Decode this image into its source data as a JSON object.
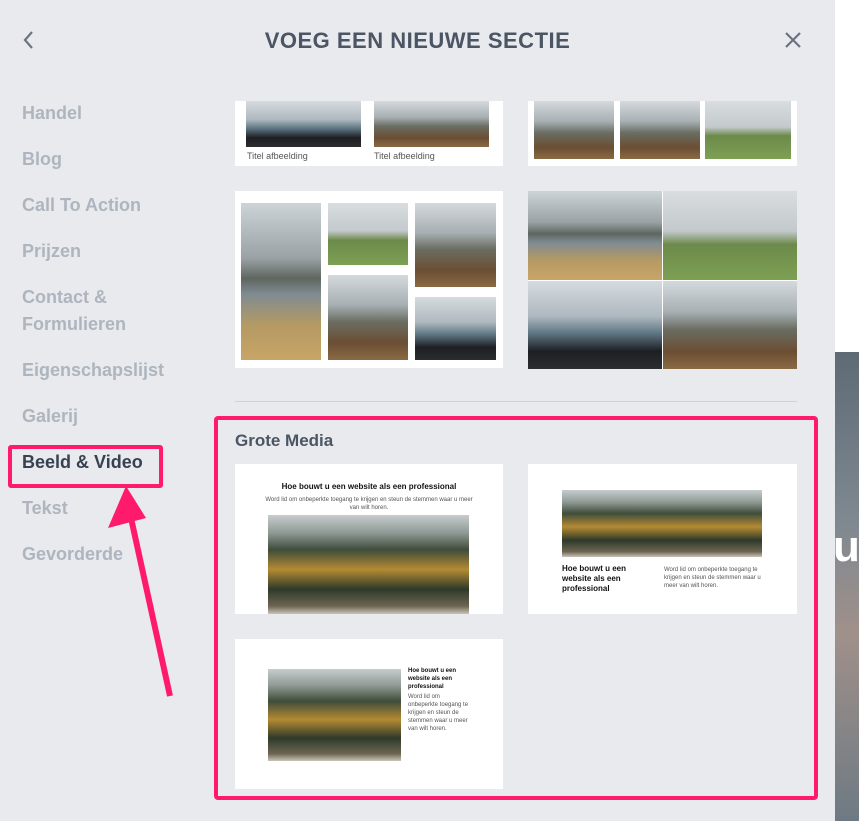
{
  "header": {
    "title": "VOEG EEN NIEUWE SECTIE"
  },
  "sidebar": {
    "items": [
      {
        "label": "Handel"
      },
      {
        "label": "Blog"
      },
      {
        "label": "Call To Action"
      },
      {
        "label": "Prijzen"
      },
      {
        "label": "Contact & Formulieren"
      },
      {
        "label": "Eigenschapslijst"
      },
      {
        "label": "Galerij"
      },
      {
        "label": "Beeld & Video"
      },
      {
        "label": "Tekst"
      },
      {
        "label": "Gevorderde"
      }
    ],
    "active": "Beeld & Video"
  },
  "gallery_top": {
    "captions": [
      "Titel afbeelding",
      "Titel afbeelding"
    ]
  },
  "section": {
    "title": "Grote Media",
    "heading": "Hoe bouwt u een website als een professional",
    "paragraph": "Word lid om onbeperkte toegang te krijgen en steun de stemmen waar u meer van wilt horen."
  },
  "colors": {
    "highlight": "#ff1a6b",
    "panel": "#e8eaee",
    "active_text": "#374151",
    "inactive_text": "#aeb5bf"
  },
  "icons": {
    "back": "chevron-left-icon",
    "close": "close-icon"
  }
}
